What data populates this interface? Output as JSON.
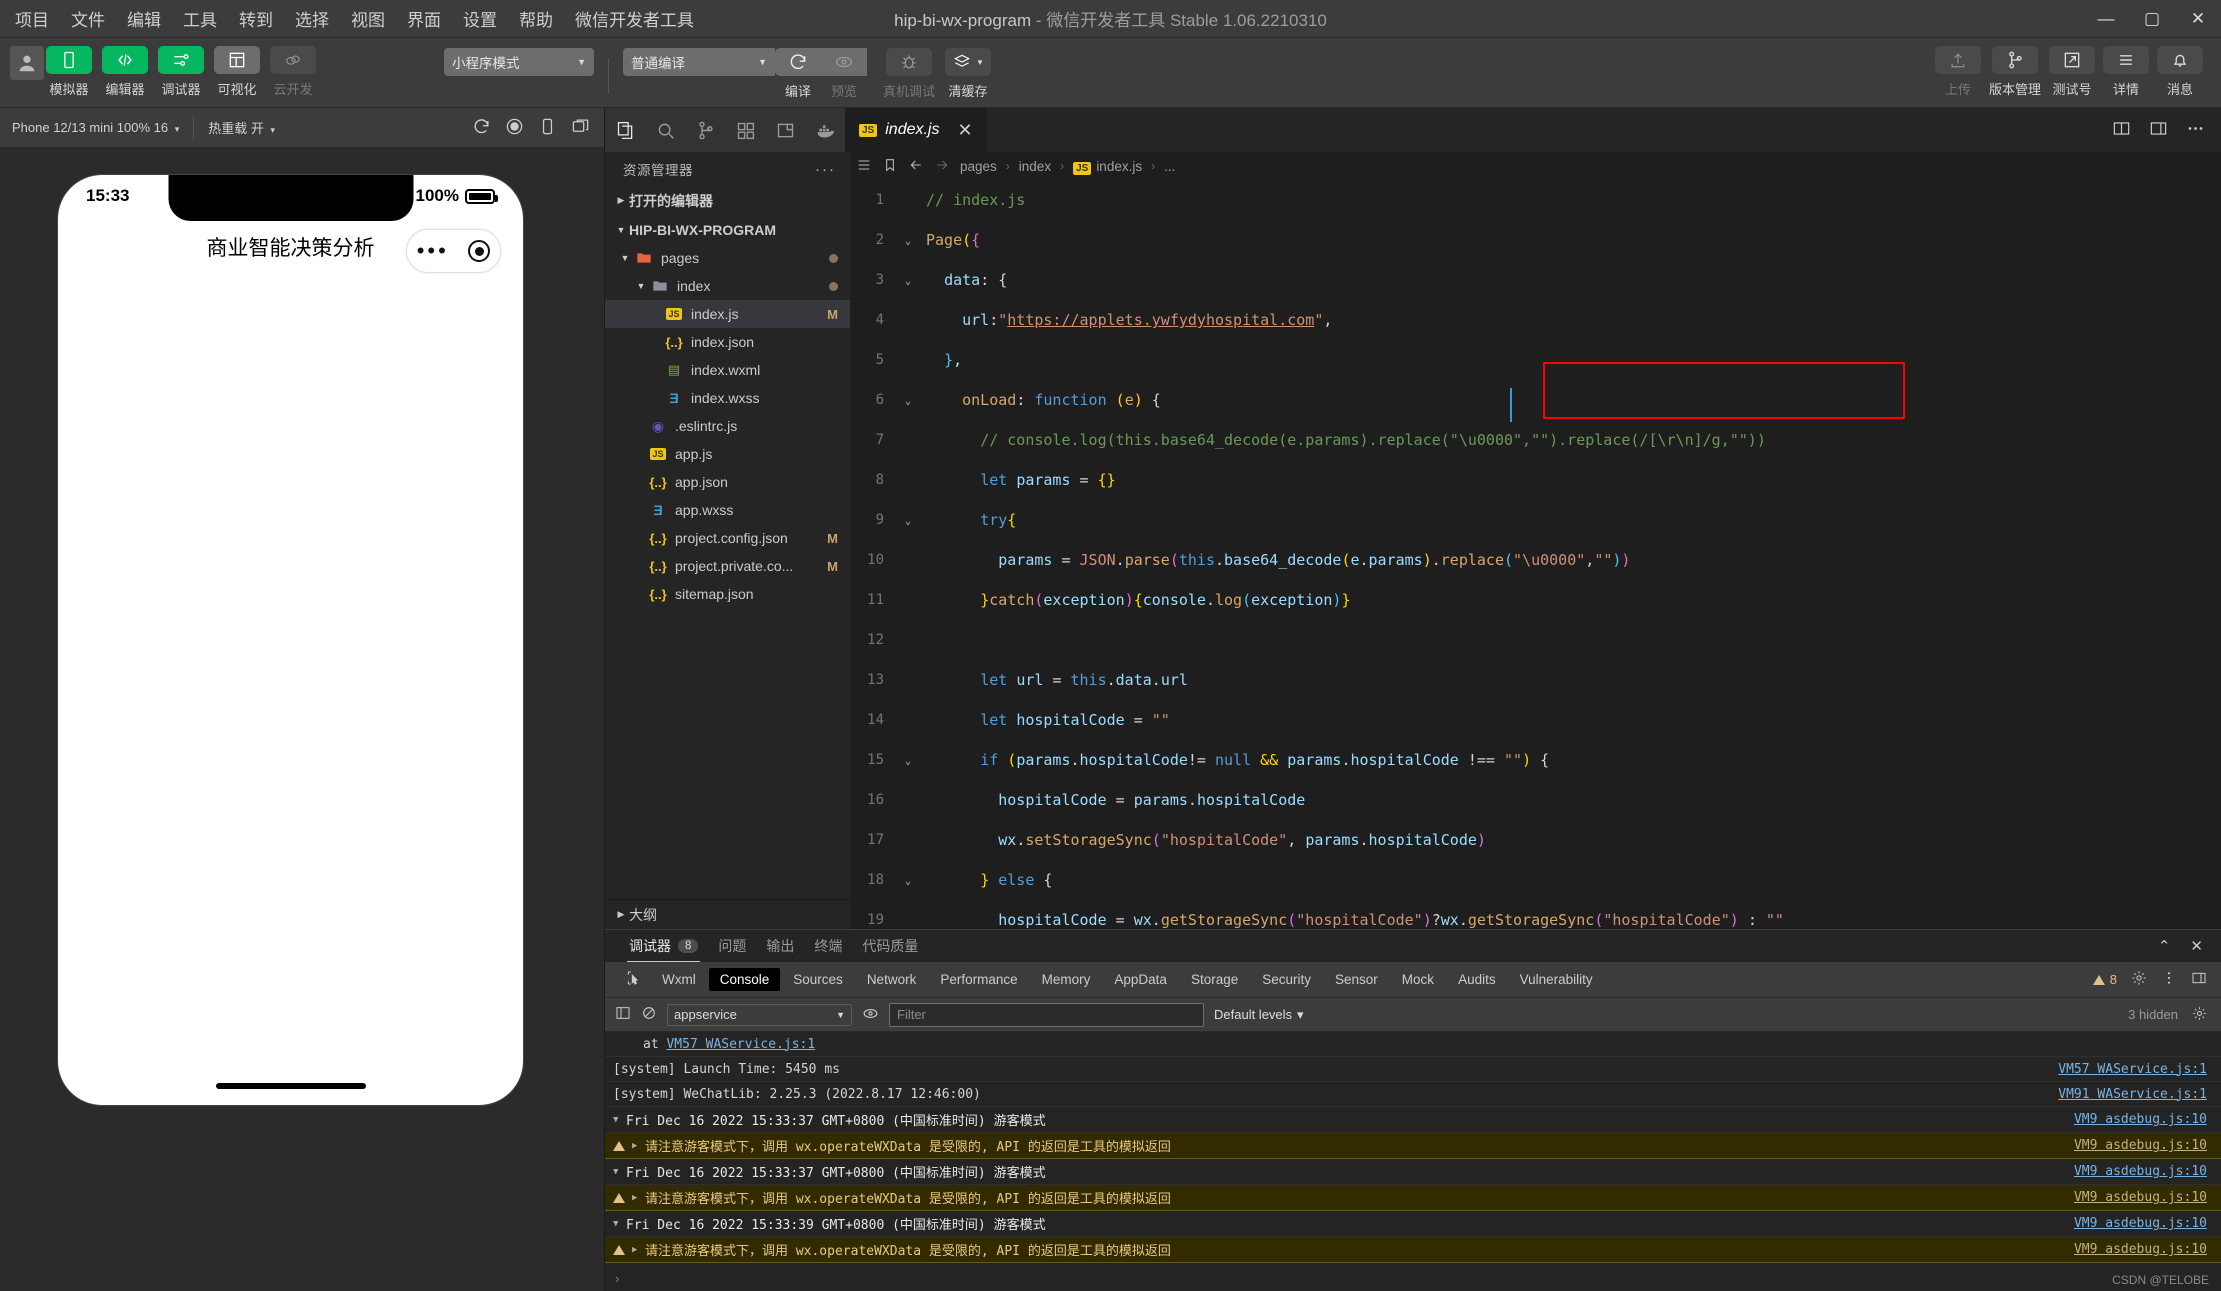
{
  "titlebar": {
    "menus": [
      "项目",
      "文件",
      "编辑",
      "工具",
      "转到",
      "选择",
      "视图",
      "界面",
      "设置",
      "帮助",
      "微信开发者工具"
    ],
    "project_name": "hip-bi-wx-program",
    "title_suffix": "- 微信开发者工具 Stable 1.06.2210310",
    "window_buttons": {
      "minimize": "—",
      "maximize": "▢",
      "close": "✕"
    }
  },
  "toolbar": {
    "left_buttons": [
      {
        "label": "模拟器",
        "icon": "phone-icon",
        "style": "green"
      },
      {
        "label": "编辑器",
        "icon": "code-icon",
        "style": "green"
      },
      {
        "label": "调试器",
        "icon": "sliders-icon",
        "style": "green"
      },
      {
        "label": "可视化",
        "icon": "layout-icon",
        "style": "grey"
      },
      {
        "label": "云开发",
        "icon": "cloud-icon",
        "style": "dark"
      }
    ],
    "mode_select": "小程序模式",
    "compile_select": "普通编译",
    "action_buttons": [
      {
        "label": "编译",
        "icon": "refresh-icon"
      },
      {
        "label": "预览",
        "icon": "eye-icon"
      },
      {
        "label": "真机调试",
        "icon": "bug-icon"
      },
      {
        "label": "清缓存",
        "icon": "layers-icon"
      }
    ],
    "right_buttons": [
      {
        "label": "上传",
        "icon": "upload-icon",
        "dim": true
      },
      {
        "label": "版本管理",
        "icon": "branch-icon",
        "dim": false
      },
      {
        "label": "测试号",
        "icon": "external-link-icon",
        "dim": false
      },
      {
        "label": "详情",
        "icon": "menu-icon",
        "dim": false
      },
      {
        "label": "消息",
        "icon": "bell-icon",
        "dim": false
      }
    ]
  },
  "simulator": {
    "device": "Phone 12/13 mini 100% 16",
    "hot_reload": "热重载 开",
    "icons": [
      "refresh-icon",
      "record-icon",
      "device-icon",
      "window-icon"
    ],
    "phone": {
      "time": "15:33",
      "battery_text": "100%",
      "page_title": "商业智能决策分析",
      "capsule_dots": "•••"
    }
  },
  "activitybar": {
    "icons": [
      "files-icon",
      "search-icon",
      "source-control-icon",
      "extensions-icon",
      "split-editor-icon",
      "docker-icon"
    ]
  },
  "tabs": {
    "open_file": "index.js",
    "badge": "JS",
    "close": "✕",
    "right_icons": [
      "split-vertical-icon",
      "panel-icon",
      "more-icon"
    ]
  },
  "sidebar": {
    "header": "资源管理器",
    "more": "···",
    "open_editors": "打开的编辑器",
    "project_root": "HIP-BI-WX-PROGRAM",
    "outline": "大纲",
    "items": [
      {
        "label": "pages",
        "type": "folder",
        "indent": 1,
        "status": "dot",
        "icon": "folder-pages-icon"
      },
      {
        "label": "index",
        "type": "folder",
        "indent": 2,
        "status": "dot",
        "icon": "folder-icon"
      },
      {
        "label": "index.js",
        "type": "js",
        "indent": 3,
        "status": "M",
        "selected": true,
        "icon": "js-icon"
      },
      {
        "label": "index.json",
        "type": "json",
        "indent": 3,
        "status": "",
        "icon": "json-icon"
      },
      {
        "label": "index.wxml",
        "type": "wxml",
        "indent": 3,
        "status": "",
        "icon": "wxml-icon"
      },
      {
        "label": "index.wxss",
        "type": "wxss",
        "indent": 3,
        "status": "",
        "icon": "wxss-icon"
      },
      {
        "label": ".eslintrc.js",
        "type": "eslint",
        "indent": 2,
        "status": "",
        "icon": "eslint-icon"
      },
      {
        "label": "app.js",
        "type": "js",
        "indent": 2,
        "status": "",
        "icon": "js-icon"
      },
      {
        "label": "app.json",
        "type": "json",
        "indent": 2,
        "status": "",
        "icon": "json-icon"
      },
      {
        "label": "app.wxss",
        "type": "wxss",
        "indent": 2,
        "status": "",
        "icon": "wxss-icon"
      },
      {
        "label": "project.config.json",
        "type": "json",
        "indent": 2,
        "status": "M",
        "icon": "json-icon"
      },
      {
        "label": "project.private.co...",
        "type": "json",
        "indent": 2,
        "status": "M",
        "icon": "json-icon"
      },
      {
        "label": "sitemap.json",
        "type": "json",
        "indent": 2,
        "status": "",
        "icon": "json-icon"
      }
    ]
  },
  "breadcrumb": {
    "parts": [
      "pages",
      "index",
      "index.js",
      "..."
    ],
    "separator": "›"
  },
  "code": {
    "lines": [
      {
        "n": "1",
        "fold": "",
        "html": "<span class=\"t-com\">// index.js</span>"
      },
      {
        "n": "2",
        "fold": "⌄",
        "html": "<span class=\"t-org\">Page</span><span class=\"t-yel\">(</span><span class=\"t-mag\">{</span>"
      },
      {
        "n": "3",
        "fold": "⌄",
        "html": "  <span class=\"t-var\">data</span><span class=\"t-pun\">: {</span>"
      },
      {
        "n": "4",
        "fold": "",
        "html": "    <span class=\"t-var\">url</span><span class=\"t-pun\">:</span><span class=\"t-str\">\"</span><span class=\"t-url\">https://applets.ywfydyhospital.com</span><span class=\"t-str\">\"</span><span class=\"t-pun\">,</span>"
      },
      {
        "n": "5",
        "fold": "",
        "html": "  <span class=\"t-blu\">}</span><span class=\"t-pun\">,</span>"
      },
      {
        "n": "6",
        "fold": "⌄",
        "html": "    <span class=\"t-org\">onLoad</span><span class=\"t-pun\">: </span><span class=\"t-key\">function</span> <span class=\"t-yel\">(</span><span class=\"t-org\">e</span><span class=\"t-yel\">)</span> <span class=\"t-pun\">{</span>"
      },
      {
        "n": "7",
        "fold": "",
        "html": "      <span class=\"t-com\">// console.log(this.base64_decode(e.params).replace(\"\\u0000\",\"\").replace(/[\\r\\n]/g,\"\"))</span>"
      },
      {
        "n": "8",
        "fold": "",
        "html": "      <span class=\"t-key\">let</span> <span class=\"t-var\">params</span> <span class=\"t-pun\">= </span><span class=\"t-yel\">{}</span>"
      },
      {
        "n": "9",
        "fold": "⌄",
        "html": "      <span class=\"t-key\">try</span><span class=\"t-yel\">{</span>"
      },
      {
        "n": "10",
        "fold": "",
        "html": "        <span class=\"t-var\">params</span> <span class=\"t-pun\">= </span><span class=\"t-str\">JSON</span><span class=\"t-pun\">.</span><span class=\"t-org\">parse</span><span class=\"t-mag\">(</span><span class=\"t-key\">this</span><span class=\"t-pun\">.</span><span class=\"t-var\">base64_decode</span><span class=\"t-yel\">(</span><span class=\"t-var\">e</span><span class=\"t-pun\">.</span><span class=\"t-var\">params</span><span class=\"t-yel\">)</span><span class=\"t-pun\">.</span><span class=\"t-org\">replace</span><span class=\"t-blu\">(</span><span class=\"t-str\">\"\\u0000\"</span><span class=\"t-pun\">,</span><span class=\"t-str\">\"\"</span><span class=\"t-blu\">)</span><span class=\"t-mag\">)</span>"
      },
      {
        "n": "11",
        "fold": "",
        "html": "      <span class=\"t-yel\">}</span><span class=\"t-org\">catch</span><span class=\"t-mag\">(</span><span class=\"t-var\">exception</span><span class=\"t-mag\">)</span><span class=\"t-yel\">{</span><span class=\"t-var\">console</span><span class=\"t-pun\">.</span><span class=\"t-org\">log</span><span class=\"t-blu\">(</span><span class=\"t-var\">exception</span><span class=\"t-blu\">)</span><span class=\"t-yel\">}</span>"
      },
      {
        "n": "12",
        "fold": "",
        "html": ""
      },
      {
        "n": "13",
        "fold": "",
        "html": "      <span class=\"t-key\">let</span> <span class=\"t-var\">url</span> <span class=\"t-pun\">= </span><span class=\"t-key\">this</span><span class=\"t-pun\">.</span><span class=\"t-var\">data</span><span class=\"t-pun\">.</span><span class=\"t-var\">url</span>"
      },
      {
        "n": "14",
        "fold": "",
        "html": "      <span class=\"t-key\">let</span> <span class=\"t-var\">hospitalCode</span> <span class=\"t-pun\">= </span><span class=\"t-str\">\"\"</span>"
      },
      {
        "n": "15",
        "fold": "⌄",
        "html": "      <span class=\"t-key\">if</span> <span class=\"t-yel\">(</span><span class=\"t-var\">params</span><span class=\"t-pun\">.</span><span class=\"t-var\">hospitalCode</span><span class=\"t-pun\">!= </span><span class=\"t-key\">null</span> <span class=\"t-yel\">&amp;&amp;</span> <span class=\"t-var\">params</span><span class=\"t-pun\">.</span><span class=\"t-var\">hospitalCode</span> <span class=\"t-pun\">!== </span><span class=\"t-str\">\"\"</span><span class=\"t-yel\">)</span> <span class=\"t-pun\">{</span>"
      },
      {
        "n": "16",
        "fold": "",
        "html": "        <span class=\"t-var\">hospitalCode</span> <span class=\"t-pun\">= </span><span class=\"t-var\">params</span><span class=\"t-pun\">.</span><span class=\"t-var\">hospitalCode</span>"
      },
      {
        "n": "17",
        "fold": "",
        "html": "        <span class=\"t-var\">wx</span><span class=\"t-pun\">.</span><span class=\"t-org\">setStorageSync</span><span class=\"t-mag\">(</span><span class=\"t-str\">\"hospitalCode\"</span><span class=\"t-pun\">, </span><span class=\"t-var\">params</span><span class=\"t-pun\">.</span><span class=\"t-var\">hospitalCode</span><span class=\"t-mag\">)</span>"
      },
      {
        "n": "18",
        "fold": "⌄",
        "html": "      <span class=\"t-yel\">}</span> <span class=\"t-key\">else</span> <span class=\"t-pun\">{</span>"
      },
      {
        "n": "19",
        "fold": "",
        "html": "        <span class=\"t-var\">hospitalCode</span> <span class=\"t-pun\">= </span><span class=\"t-var\">wx</span><span class=\"t-pun\">.</span><span class=\"t-org\">getStorageSync</span><span class=\"t-mag\">(</span><span class=\"t-str\">\"hospitalCode\"</span><span class=\"t-mag\">)</span><span class=\"t-pun\">?</span><span class=\"t-var\">wx</span><span class=\"t-pun\">.</span><span class=\"t-org\">getStorageSync</span><span class=\"t-mag\">(</span><span class=\"t-str\">\"hospitalCode\"</span><span class=\"t-mag\">)</span> <span class=\"t-pun\">: </span><span class=\"t-str\">\"\"</span>"
      }
    ]
  },
  "devtools": {
    "panel_tabs": [
      {
        "label": "调试器",
        "badge": "8",
        "active": true
      },
      {
        "label": "问题",
        "badge": "",
        "active": false
      },
      {
        "label": "输出",
        "badge": "",
        "active": false
      },
      {
        "label": "终端",
        "badge": "",
        "active": false
      },
      {
        "label": "代码质量",
        "badge": "",
        "active": false
      }
    ],
    "panel_controls": {
      "collapse": "⌃",
      "close": "✕"
    },
    "tools": [
      "Wxml",
      "Console",
      "Sources",
      "Network",
      "Performance",
      "Memory",
      "AppData",
      "Storage",
      "Security",
      "Sensor",
      "Mock",
      "Audits",
      "Vulnerability"
    ],
    "active_tool": "Console",
    "warning_count": "8",
    "context": "appservice",
    "filter_placeholder": "Filter",
    "levels": "Default levels",
    "hidden_text": "3 hidden",
    "messages": [
      {
        "type": "plain",
        "indent": true,
        "text": "at VM57 WAService.js:1",
        "link_text": "VM57 WAService.js:1",
        "source": ""
      },
      {
        "type": "plain",
        "text": "[system] Launch Time: 5450 ms",
        "source": "VM57 WAService.js:1"
      },
      {
        "type": "plain",
        "text": "[system] WeChatLib: 2.25.3 (2022.8.17 12:46:00)",
        "source": "VM91 WAService.js:1"
      },
      {
        "type": "group",
        "text": "Fri Dec 16 2022 15:33:37 GMT+0800 (中国标准时间) 游客模式",
        "source": "VM9 asdebug.js:10"
      },
      {
        "type": "warn",
        "text": "请注意游客模式下，调用 wx.operateWXData 是受限的, API 的返回是工具的模拟返回",
        "source": "VM9 asdebug.js:10"
      },
      {
        "type": "group",
        "text": "Fri Dec 16 2022 15:33:37 GMT+0800 (中国标准时间) 游客模式",
        "source": "VM9 asdebug.js:10"
      },
      {
        "type": "warn",
        "text": "请注意游客模式下，调用 wx.operateWXData 是受限的, API 的返回是工具的模拟返回",
        "source": "VM9 asdebug.js:10"
      },
      {
        "type": "group",
        "text": "Fri Dec 16 2022 15:33:39 GMT+0800 (中国标准时间) 游客模式",
        "source": "VM9 asdebug.js:10"
      },
      {
        "type": "warn",
        "text": "请注意游客模式下，调用 wx.operateWXData 是受限的, API 的返回是工具的模拟返回",
        "source": "VM9 asdebug.js:10"
      }
    ],
    "prompt": "›"
  },
  "watermark": "CSDN @TELOBE",
  "colors": {
    "accent_green": "#07b760",
    "highlight_red": "#ff0000",
    "warn_bg": "#332b00"
  }
}
